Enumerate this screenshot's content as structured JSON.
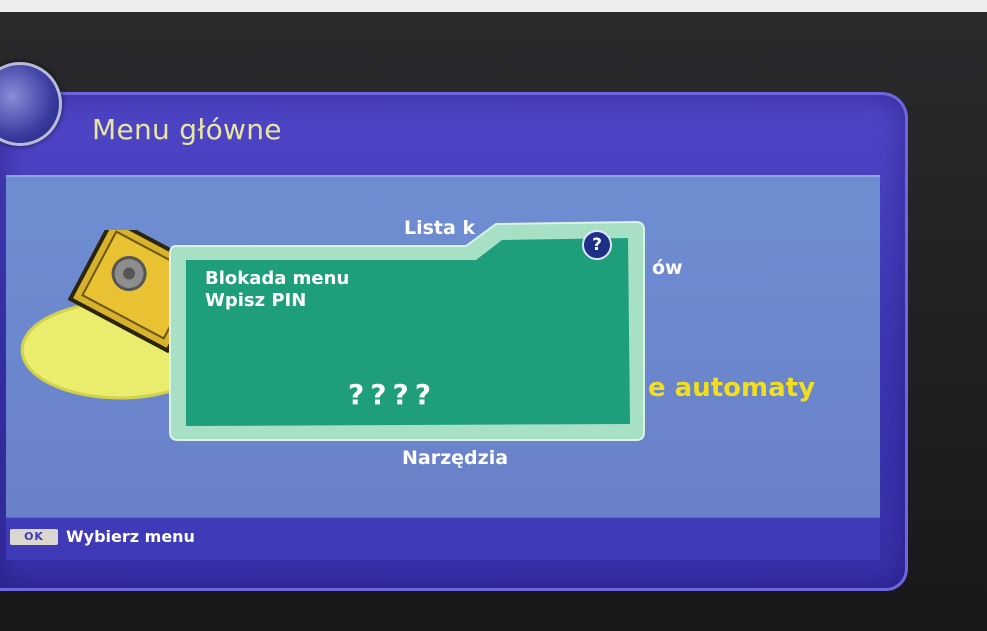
{
  "header": {
    "title": "Menu główne"
  },
  "menu": {
    "items": [
      {
        "label": "Lista k"
      },
      {
        "label": "ów"
      },
      {
        "label": "e automaty"
      },
      {
        "label": "Narzędzia"
      }
    ]
  },
  "dialog": {
    "title": "Blokada menu",
    "prompt": "Wpisz PIN",
    "pin_value": "????",
    "help_symbol": "?"
  },
  "footer": {
    "ok_key": "OK",
    "hint": "Wybierz menu"
  },
  "icons": {
    "help": "help-icon",
    "dial": "dial-icon",
    "gear": "gear-sign-icon"
  },
  "colors": {
    "frame": "#3c36b3",
    "panel": "#6b86cd",
    "dialog": "#1d9b7a",
    "title": "#e8e6a0",
    "highlight": "#f2de1e"
  }
}
